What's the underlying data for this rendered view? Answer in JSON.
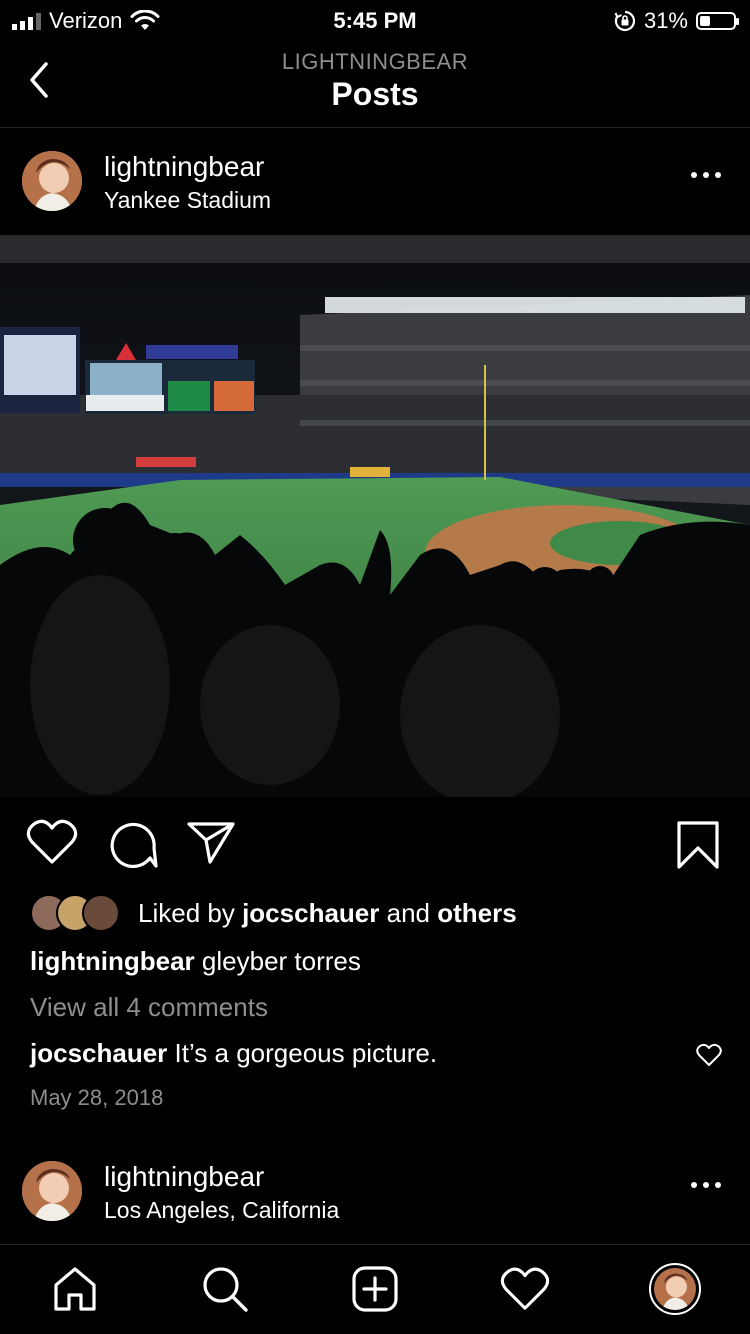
{
  "status_bar": {
    "carrier": "Verizon",
    "time": "5:45 PM",
    "battery": "31%"
  },
  "nav": {
    "subtitle": "LIGHTNINGBEAR",
    "title": "Posts"
  },
  "post": {
    "username": "lightningbear",
    "location": "Yankee Stadium",
    "photo_alt": "Yankee Stadium at night",
    "liked_by_prefix": "Liked by",
    "liked_by_user": "jocschauer",
    "liked_by_and": "and",
    "liked_by_others": "others",
    "caption_user": "lightningbear",
    "caption_text": "gleyber torres",
    "view_all_comments": "View all 4 comments",
    "comment_user": "jocschauer",
    "comment_text": "It’s a gorgeous picture.",
    "date": "May 28, 2018"
  },
  "next_post": {
    "username": "lightningbear",
    "location": "Los Angeles, California"
  },
  "icons": {
    "back": "chevron-left-icon",
    "more": "more-icon",
    "like": "heart-icon",
    "comment": "comment-icon",
    "share": "send-icon",
    "save": "bookmark-icon",
    "home": "home-icon",
    "search": "search-icon",
    "new_post": "add-post-icon",
    "activity": "heart-icon",
    "profile": "avatar"
  },
  "colors": {
    "background": "#000000",
    "muted_text": "#8e8e8e",
    "divider": "#262626"
  }
}
